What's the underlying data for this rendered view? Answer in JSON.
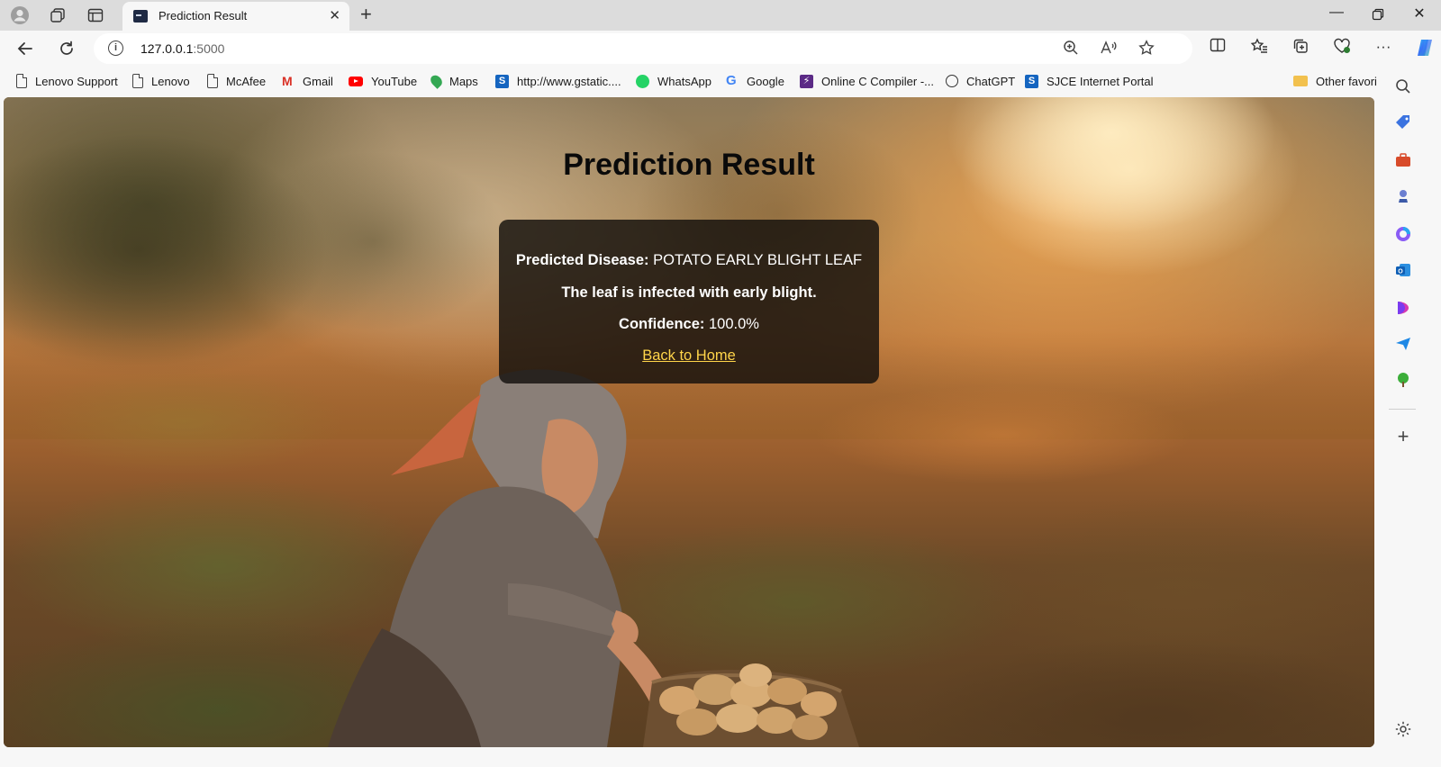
{
  "browser": {
    "tab_title": "Prediction Result",
    "url_host": "127.0.0.1",
    "url_port": ":5000"
  },
  "bookmarks": [
    {
      "label": "Lenovo Support",
      "icon": "page-icon"
    },
    {
      "label": "Lenovo",
      "icon": "page-icon"
    },
    {
      "label": "McAfee",
      "icon": "page-icon"
    },
    {
      "label": "Gmail",
      "icon": "gmail-icon"
    },
    {
      "label": "YouTube",
      "icon": "youtube-icon"
    },
    {
      "label": "Maps",
      "icon": "maps-icon"
    },
    {
      "label": "http://www.gstatic....",
      "icon": "s-icon"
    },
    {
      "label": "WhatsApp",
      "icon": "whatsapp-icon"
    },
    {
      "label": "Google",
      "icon": "google-icon"
    },
    {
      "label": "Online C Compiler -...",
      "icon": "compiler-icon"
    },
    {
      "label": "ChatGPT",
      "icon": "chatgpt-icon"
    },
    {
      "label": "SJCE Internet Portal",
      "icon": "s-icon"
    }
  ],
  "other_favorites": "Other favorites",
  "page": {
    "title": "Prediction Result",
    "disease_label": "Predicted Disease:",
    "disease_value": "POTATO EARLY BLIGHT LEAF",
    "description": "The leaf is infected with early blight.",
    "confidence_label": "Confidence:",
    "confidence_value": "100.0%",
    "back_link": "Back to Home"
  },
  "colors": {
    "link": "#ffd54a",
    "card_bg": "#14100c",
    "chrome_bg": "#f7f7f7",
    "titlebar_bg": "#dcdcdc"
  }
}
